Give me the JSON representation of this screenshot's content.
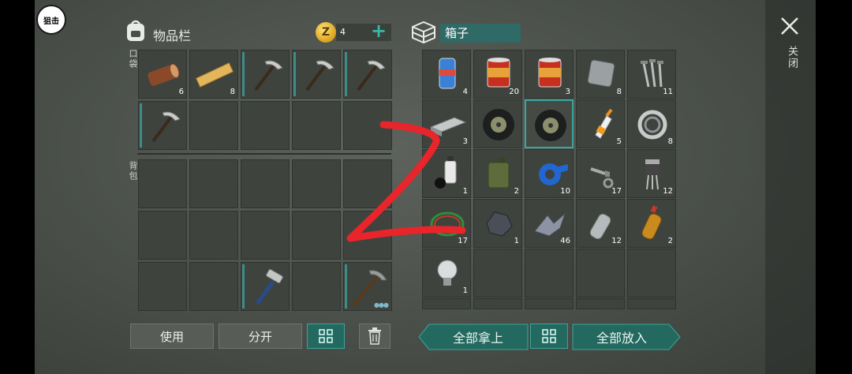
{
  "overlay": {
    "snipe_button": "狙击"
  },
  "inventory": {
    "title": "物品栏",
    "coins": "4",
    "coin_symbol": "Z",
    "pocket_label": "口袋",
    "backpack_label": "背包"
  },
  "container": {
    "name": "箱子"
  },
  "close": {
    "label": "关闭"
  },
  "actions": {
    "use": "使用",
    "split": "分开",
    "take_all": "全部拿上",
    "put_all": "全部放入"
  },
  "pocket_slots": [
    {
      "item": "log-icon",
      "qty": "6"
    },
    {
      "item": "plank-icon",
      "qty": "8"
    },
    {
      "item": "pickaxe-icon",
      "qty": ""
    },
    {
      "item": "pickaxe-icon",
      "qty": ""
    },
    {
      "item": "pickaxe-icon",
      "qty": ""
    },
    {
      "item": "pickaxe-icon",
      "qty": ""
    }
  ],
  "backpack_slots": [
    {
      "item": "hammer-icon",
      "qty": ""
    },
    {
      "item": "pickaxe-large-icon",
      "qty": ""
    }
  ],
  "box_items": [
    {
      "item": "soda-can-icon",
      "qty": "4"
    },
    {
      "item": "canned-food-icon",
      "qty": "20"
    },
    {
      "item": "canned-food-icon",
      "qty": "3"
    },
    {
      "item": "metal-plate-icon",
      "qty": "8"
    },
    {
      "item": "nails-icon",
      "qty": "11"
    },
    {
      "item": "metal-bar-icon",
      "qty": "3"
    },
    {
      "item": "tire-icon",
      "qty": ""
    },
    {
      "item": "tire-icon",
      "qty": ""
    },
    {
      "item": "glue-icon",
      "qty": "5"
    },
    {
      "item": "bearing-icon",
      "qty": "8"
    },
    {
      "item": "spray-paint-icon",
      "qty": "1"
    },
    {
      "item": "jerrycan-icon",
      "qty": "2"
    },
    {
      "item": "duct-tape-icon",
      "qty": "10"
    },
    {
      "item": "bolts-icon",
      "qty": "17"
    },
    {
      "item": "transistor-icon",
      "qty": "12"
    },
    {
      "item": "wire-coil-icon",
      "qty": "17"
    },
    {
      "item": "ore-icon",
      "qty": "1"
    },
    {
      "item": "scrap-metal-icon",
      "qty": "46"
    },
    {
      "item": "plastic-bottle-icon",
      "qty": "12"
    },
    {
      "item": "oil-bottle-icon",
      "qty": "2"
    },
    {
      "item": "light-bulb-icon",
      "qty": "1"
    }
  ],
  "colors": {
    "accent": "#24695f",
    "highlight": "#3aa5a0",
    "coin": "#d8a11a",
    "annotation": "#e8252a"
  }
}
